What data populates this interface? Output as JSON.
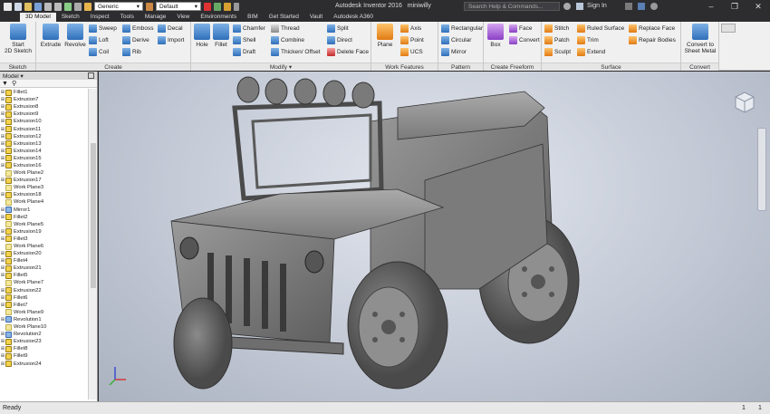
{
  "window": {
    "title": "Autodesk Inventor 2016",
    "document": "miniwilly",
    "search_placeholder": "Search Help & Commands...",
    "sign_in": "Sign In",
    "minimize_glyph": "–",
    "maximize_glyph": "❐",
    "close_glyph": "✕"
  },
  "qat": {
    "material_value": "Generic",
    "appearance_value": "Default"
  },
  "tabs": [
    "3D Model",
    "Sketch",
    "Inspect",
    "Tools",
    "Manage",
    "View",
    "Environments",
    "BIM",
    "Get Started",
    "Vault",
    "Autodesk A360"
  ],
  "ribbon": {
    "sketch": {
      "label": "Sketch",
      "start": "Start",
      "start2": "2D Sketch"
    },
    "create": {
      "label": "Create",
      "extrude": "Extrude",
      "revolve": "Revolve",
      "sweep": "Sweep",
      "loft": "Loft",
      "coil": "Coil",
      "emboss": "Emboss",
      "derive": "Derive",
      "rib": "Rib",
      "decal": "Decal",
      "import": "Import"
    },
    "modify": {
      "label": "Modify",
      "hole": "Hole",
      "fillet": "Fillet",
      "chamfer": "Chamfer",
      "shell": "Shell",
      "draft": "Draft",
      "thread": "Thread",
      "combine": "Combine",
      "thicken": "Thicken/ Offset",
      "split": "Split",
      "direct": "Direct",
      "delete_face": "Delete Face"
    },
    "work_features": {
      "label": "Work Features",
      "plane": "Plane",
      "axis": "Axis",
      "point": "Point",
      "ucs": "UCS"
    },
    "pattern": {
      "label": "Pattern",
      "rectangular": "Rectangular",
      "circular": "Circular",
      "mirror": "Mirror"
    },
    "freeform": {
      "label": "Create Freeform",
      "box": "Box",
      "face": "Face",
      "convert": "Convert"
    },
    "surface": {
      "label": "Surface",
      "stitch": "Stitch",
      "patch": "Patch",
      "sculpt": "Sculpt",
      "ruled_surface": "Ruled Surface",
      "trim": "Trim",
      "extend": "Extend",
      "replace_face": "Replace Face",
      "repair_bodies": "Repair Bodies"
    },
    "convert": {
      "label": "Convert",
      "to_sheet_metal": "Convert to",
      "to_sheet_metal2": "Sheet Metal"
    }
  },
  "browser": {
    "header": "Model",
    "items": [
      {
        "label": "Fillet1",
        "type": "fil"
      },
      {
        "label": "Extrusion7",
        "type": "ext"
      },
      {
        "label": "Extrusion8",
        "type": "ext"
      },
      {
        "label": "Extrusion9",
        "type": "ext"
      },
      {
        "label": "Extrusion10",
        "type": "ext"
      },
      {
        "label": "Extrusion11",
        "type": "ext"
      },
      {
        "label": "Extrusion12",
        "type": "ext"
      },
      {
        "label": "Extrusion13",
        "type": "ext"
      },
      {
        "label": "Extrusion14",
        "type": "ext"
      },
      {
        "label": "Extrusion15",
        "type": "ext"
      },
      {
        "label": "Extrusion16",
        "type": "ext"
      },
      {
        "label": "Work Plane2",
        "type": "wp"
      },
      {
        "label": "Extrusion17",
        "type": "ext"
      },
      {
        "label": "Work Plane3",
        "type": "wp"
      },
      {
        "label": "Extrusion18",
        "type": "ext"
      },
      {
        "label": "Work Plane4",
        "type": "wp"
      },
      {
        "label": "Mirror1",
        "type": "mir"
      },
      {
        "label": "Fillet2",
        "type": "fil"
      },
      {
        "label": "Work Plane5",
        "type": "wp"
      },
      {
        "label": "Extrusion19",
        "type": "ext"
      },
      {
        "label": "Fillet3",
        "type": "fil"
      },
      {
        "label": "Work Plane6",
        "type": "wp"
      },
      {
        "label": "Extrusion20",
        "type": "ext"
      },
      {
        "label": "Fillet4",
        "type": "fil"
      },
      {
        "label": "Extrusion21",
        "type": "ext"
      },
      {
        "label": "Fillet5",
        "type": "fil"
      },
      {
        "label": "Work Plane7",
        "type": "wp"
      },
      {
        "label": "Extrusion22",
        "type": "ext"
      },
      {
        "label": "Fillet6",
        "type": "fil"
      },
      {
        "label": "Fillet7",
        "type": "fil"
      },
      {
        "label": "Work Plane9",
        "type": "wp"
      },
      {
        "label": "Revolution1",
        "type": "rev"
      },
      {
        "label": "Work Plane10",
        "type": "wp"
      },
      {
        "label": "Revolution2",
        "type": "rev"
      },
      {
        "label": "Extrusion23",
        "type": "ext"
      },
      {
        "label": "Fillet8",
        "type": "fil"
      },
      {
        "label": "Fillet9",
        "type": "fil"
      },
      {
        "label": "Extrusion24",
        "type": "ext"
      }
    ]
  },
  "status": {
    "text": "Ready",
    "count1": "1",
    "count2": "1"
  }
}
